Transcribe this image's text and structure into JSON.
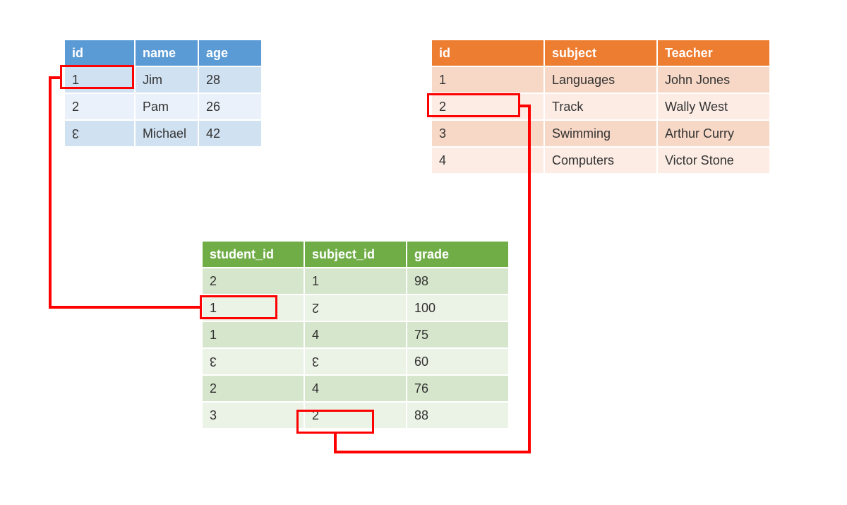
{
  "students": {
    "headers": [
      "id",
      "name",
      "age"
    ],
    "rows": [
      {
        "id": "1",
        "name": "Jim",
        "age": "28"
      },
      {
        "id": "2",
        "name": "Pam",
        "age": "26"
      },
      {
        "id": "3",
        "name": "Michael",
        "age": "42"
      }
    ]
  },
  "subjects": {
    "headers": [
      "id",
      "subject",
      "Teacher"
    ],
    "rows": [
      {
        "id": "1",
        "subject": "Languages",
        "teacher": "John Jones"
      },
      {
        "id": "2",
        "subject": "Track",
        "teacher": "Wally West"
      },
      {
        "id": "3",
        "subject": "Swimming",
        "teacher": "Arthur Curry"
      },
      {
        "id": "4",
        "subject": "Computers",
        "teacher": "Victor Stone"
      }
    ]
  },
  "grades": {
    "headers": [
      "student_id",
      "subject_id",
      "grade"
    ],
    "rows": [
      {
        "student_id": "2",
        "subject_id": "1",
        "grade": "98"
      },
      {
        "student_id": "1",
        "subject_id": "2",
        "grade": "100"
      },
      {
        "student_id": "1",
        "subject_id": "4",
        "grade": "75"
      },
      {
        "student_id": "3",
        "subject_id": "3",
        "grade": "60"
      },
      {
        "student_id": "2",
        "subject_id": "4",
        "grade": "76"
      },
      {
        "student_id": "3",
        "subject_id": "2",
        "grade": "88"
      }
    ]
  }
}
